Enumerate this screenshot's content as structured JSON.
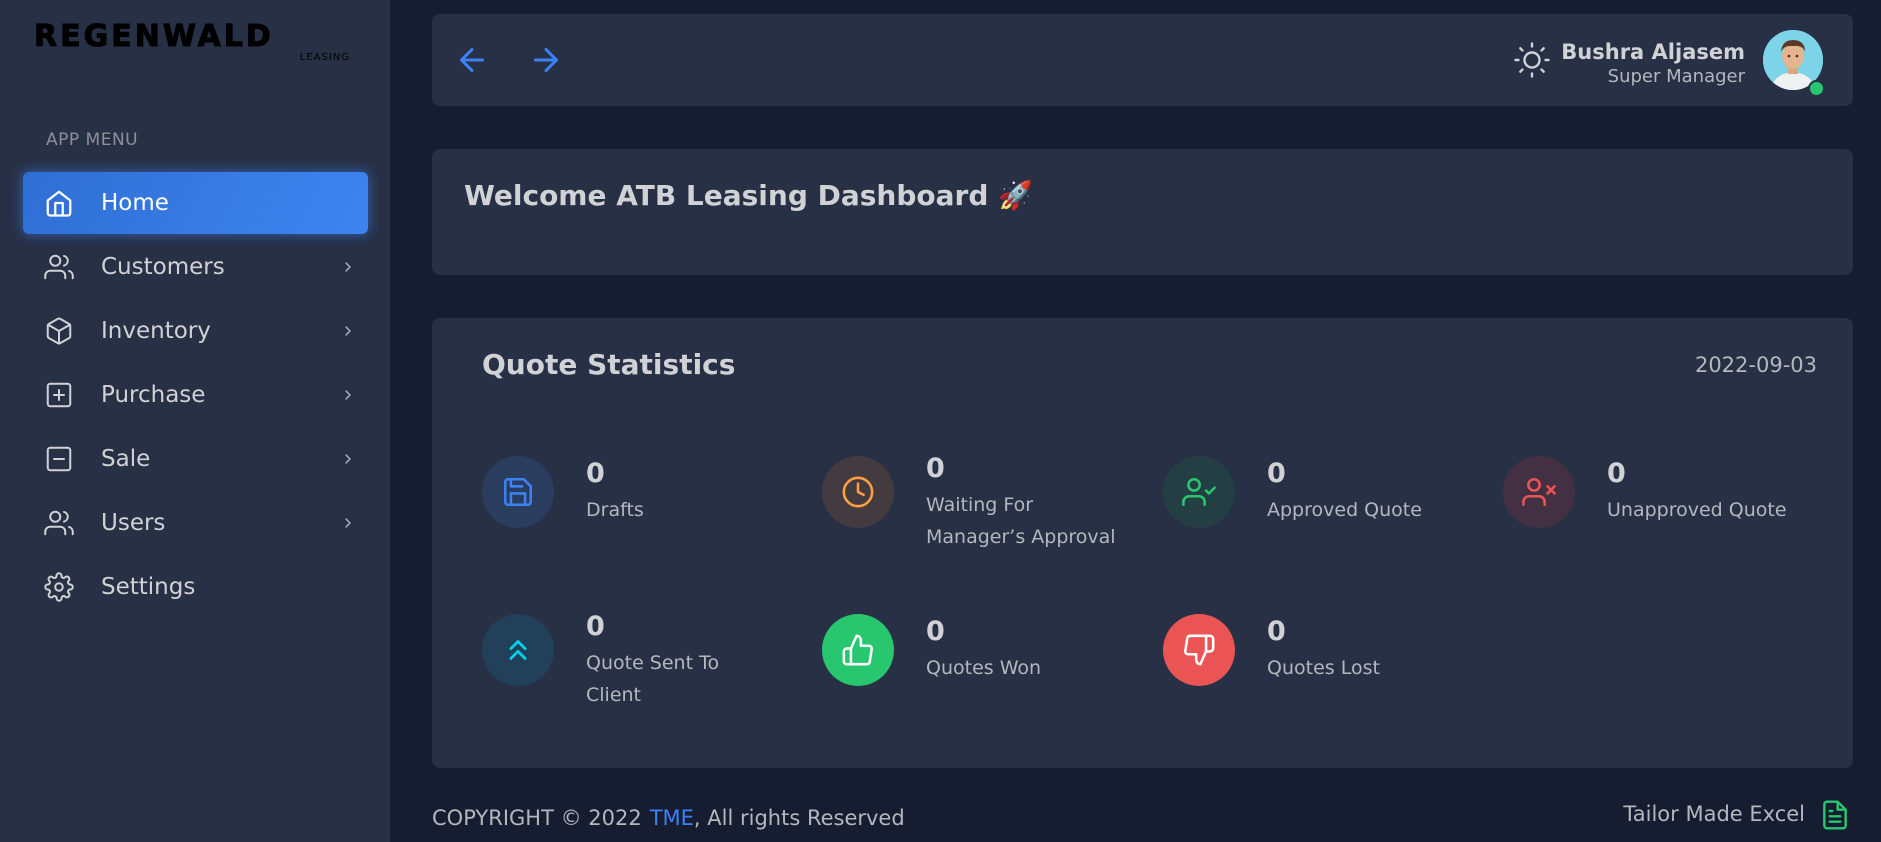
{
  "brand": {
    "logo_text": "REGENWALD",
    "logo_sub": "LEASING"
  },
  "sidebar": {
    "menu_header": "APP MENU",
    "items": [
      {
        "label": "Home",
        "icon": "home-icon",
        "active": true,
        "has_children": false
      },
      {
        "label": "Customers",
        "icon": "users-icon",
        "active": false,
        "has_children": true
      },
      {
        "label": "Inventory",
        "icon": "box-icon",
        "active": false,
        "has_children": true
      },
      {
        "label": "Purchase",
        "icon": "plus-square-icon",
        "active": false,
        "has_children": true
      },
      {
        "label": "Sale",
        "icon": "minus-square-icon",
        "active": false,
        "has_children": true
      },
      {
        "label": "Users",
        "icon": "users-icon",
        "active": false,
        "has_children": true
      },
      {
        "label": "Settings",
        "icon": "gear-icon",
        "active": false,
        "has_children": false
      }
    ]
  },
  "header": {
    "user_name": "Bushra Aljasem",
    "user_role": "Super Manager",
    "status_color": "#28c76f"
  },
  "welcome": {
    "title": "Welcome ATB Leasing Dashboard 🚀"
  },
  "stats": {
    "title": "Quote Statistics",
    "date": "2022-09-03",
    "items": [
      {
        "value": "0",
        "label": "Drafts",
        "icon": "save-icon",
        "color": "#3b82f6"
      },
      {
        "value": "0",
        "label": "Waiting For Manager’s Approval",
        "icon": "clock-icon",
        "color": "#ff9f43"
      },
      {
        "value": "0",
        "label": "Approved Quote",
        "icon": "user-check-icon",
        "color": "#28c76f"
      },
      {
        "value": "0",
        "label": "Unapproved Quote",
        "icon": "user-x-icon",
        "color": "#ea5455"
      },
      {
        "value": "0",
        "label": "Quote Sent To Client",
        "icon": "chevrons-up-icon",
        "color": "#00cfe8"
      },
      {
        "value": "0",
        "label": "Quotes Won",
        "icon": "thumbs-up-icon",
        "color": "#28c76f"
      },
      {
        "value": "0",
        "label": "Quotes Lost",
        "icon": "thumbs-down-icon",
        "color": "#ea5455"
      }
    ]
  },
  "footer": {
    "copyright_prefix": "COPYRIGHT © 2022",
    "company_link": "TME",
    "copyright_suffix": ", All rights Reserved",
    "right_text": "Tailor Made Excel"
  },
  "colors": {
    "accent": "#3b82f6",
    "card": "#283046",
    "background": "#161d31"
  }
}
